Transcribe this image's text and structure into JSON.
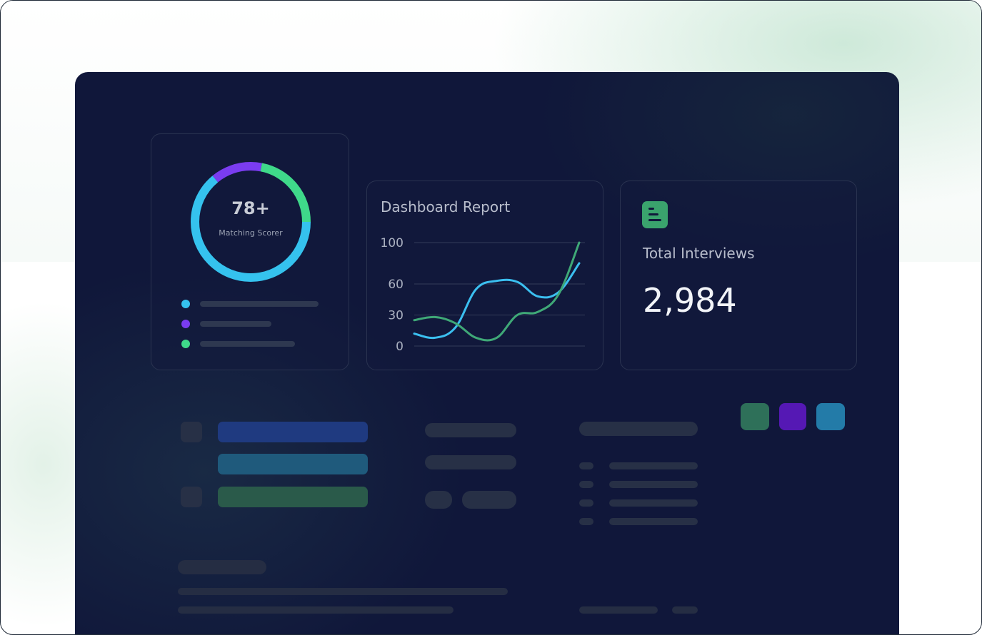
{
  "matching_card": {
    "score": "78+",
    "label": "Matching Scorer",
    "ring": {
      "segments": [
        {
          "color": "#35c2ee",
          "fraction": 0.64
        },
        {
          "color": "#7a3cf0",
          "fraction": 0.14
        },
        {
          "color": "#3fd98a",
          "fraction": 0.22
        }
      ]
    },
    "legend": [
      {
        "color": "#35c2ee"
      },
      {
        "color": "#7a3cf0"
      },
      {
        "color": "#3fd98a"
      }
    ]
  },
  "chart_card": {
    "title": "Dashboard Report"
  },
  "chart_data": {
    "type": "line",
    "title": "Dashboard Report",
    "xlabel": "",
    "ylabel": "",
    "y_ticks": [
      "100",
      "60",
      "30",
      "0"
    ],
    "y_tick_values": [
      100,
      60,
      30,
      0
    ],
    "grid": true,
    "legend": "none",
    "series": [
      {
        "color": "#3bbff0",
        "points": [
          [
            0,
            12
          ],
          [
            1,
            8
          ],
          [
            2,
            18
          ],
          [
            3,
            55
          ],
          [
            4,
            63
          ],
          [
            5,
            62
          ],
          [
            6,
            48
          ],
          [
            7,
            52
          ],
          [
            8,
            80
          ]
        ]
      },
      {
        "color": "#3fa877",
        "points": [
          [
            0,
            25
          ],
          [
            1,
            28
          ],
          [
            2,
            22
          ],
          [
            3,
            8
          ],
          [
            4,
            8
          ],
          [
            5,
            30
          ],
          [
            6,
            33
          ],
          [
            7,
            50
          ],
          [
            8,
            100
          ]
        ]
      }
    ]
  },
  "total_card": {
    "title": "Total Interviews",
    "value": "2,984",
    "icon": "document-icon",
    "icon_color": "#3aa36d"
  },
  "palette": [
    "#2e7059",
    "#5518b4",
    "#237ba8"
  ]
}
